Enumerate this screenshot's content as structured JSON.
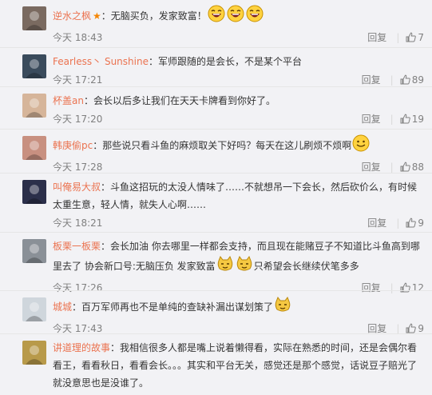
{
  "comments": [
    {
      "user": "逆水之枫",
      "vip_badge": "★",
      "text": "：无脑买负，发家致富！",
      "emojis": [
        "laugh-emoji",
        "laugh-emoji",
        "laugh-emoji"
      ],
      "time": "今天 18:43",
      "reply_label": "回复",
      "likes": "7",
      "avatar_color": "#7a6a60"
    },
    {
      "user": "Fearless丶 Sunshine",
      "text": "：军师跟随的是会长，不是某个平台",
      "time": "今天 17:21",
      "reply_label": "回复",
      "likes": "89",
      "avatar_color": "#3a4b5c"
    },
    {
      "user": "杯盖an",
      "text": "：会长以后多让我们在天天卡牌看到你好了。",
      "time": "今天 17:20",
      "reply_label": "回复",
      "likes": "19",
      "avatar_color": "#d6b59a"
    },
    {
      "user": "韩庚偷pc",
      "text": "：那些说只看斗鱼的麻烦取关下好吗？每天在这儿刷烦不烦啊",
      "emojis": [
        "smile-emoji"
      ],
      "time": "今天 17:28",
      "reply_label": "回复",
      "likes": "88",
      "avatar_color": "#c89080"
    },
    {
      "user": "叫俺易大叔",
      "text": "：斗鱼这招玩的太没人情味了……不就想吊一下会长，然后砍价么，有时候太重生意，轻人情，就失人心啊……",
      "time": "今天 18:21",
      "reply_label": "回复",
      "likes": "9",
      "avatar_color": "#2b2f4a"
    },
    {
      "user": "板栗一板栗",
      "text": "：会长加油 你去哪里一样都会支持，而且现在能赌豆子不知道比斗鱼高到哪里去了 协会新口号:无脑压负 发家致富",
      "emojis": [
        "cat-emoji",
        "cat-emoji"
      ],
      "text_after": "只希望会长继续伏笔多多",
      "time": "今天 17:26",
      "reply_label": "回复",
      "likes": "12",
      "avatar_color": "#8a9097"
    },
    {
      "user": "城城",
      "text": "：百万军师再也不是单纯的查缺补漏出谋划策了",
      "emojis": [
        "cat-emoji"
      ],
      "time": "今天 17:43",
      "reply_label": "回复",
      "likes": "9",
      "avatar_color": "#cfd6dc"
    },
    {
      "user": "讲道理的故事",
      "text": "：我相信很多人都是嘴上说着懒得看，实际在熟悉的时间，还是会偶尔看看王，看看秋日，看看会长。。。其实和平台无关，感觉还是那个感觉，话说豆子赔光了就没意思也是没谁了。",
      "time": "",
      "reply_label": "",
      "likes": "",
      "avatar_color": "#b89a4a"
    }
  ]
}
